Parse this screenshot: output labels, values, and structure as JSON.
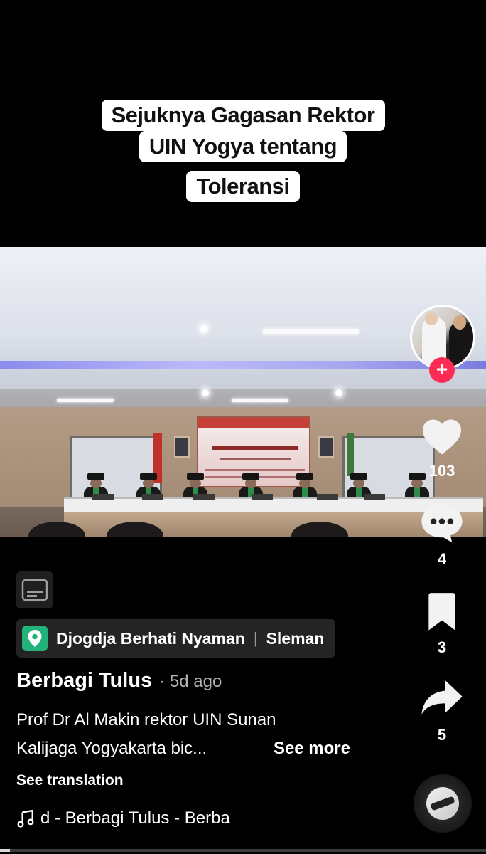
{
  "caption": {
    "lines": [
      "Sejuknya Gagasan Rektor",
      "UIN Yogya tentang",
      "Toleransi"
    ]
  },
  "rail": {
    "follow_symbol": "+",
    "likes": "103",
    "comments": "4",
    "saves": "3",
    "shares": "5"
  },
  "location": {
    "name": "Djogdja Berhati Nyaman",
    "separator": "|",
    "city": "Sleman"
  },
  "post": {
    "author": "Berbagi Tulus",
    "time": "· 5d ago",
    "desc_line1": "Prof Dr Al Makin rektor UIN Sunan",
    "desc_line2": "Kalijaga Yogyakarta bic...",
    "see_more": "See more",
    "see_translation": "See translation"
  },
  "sound": {
    "text": "d - Berbagi Tulus - Berba"
  },
  "playback": {
    "progress_fraction": 0.02
  },
  "icons": [
    "heart-icon",
    "comment-icon",
    "bookmark-icon",
    "share-icon",
    "captions-icon",
    "location-pin-icon",
    "music-note-icon"
  ],
  "colors": {
    "accent": "#fe2c55",
    "location_pin": "#23b27a",
    "background": "#000000"
  }
}
